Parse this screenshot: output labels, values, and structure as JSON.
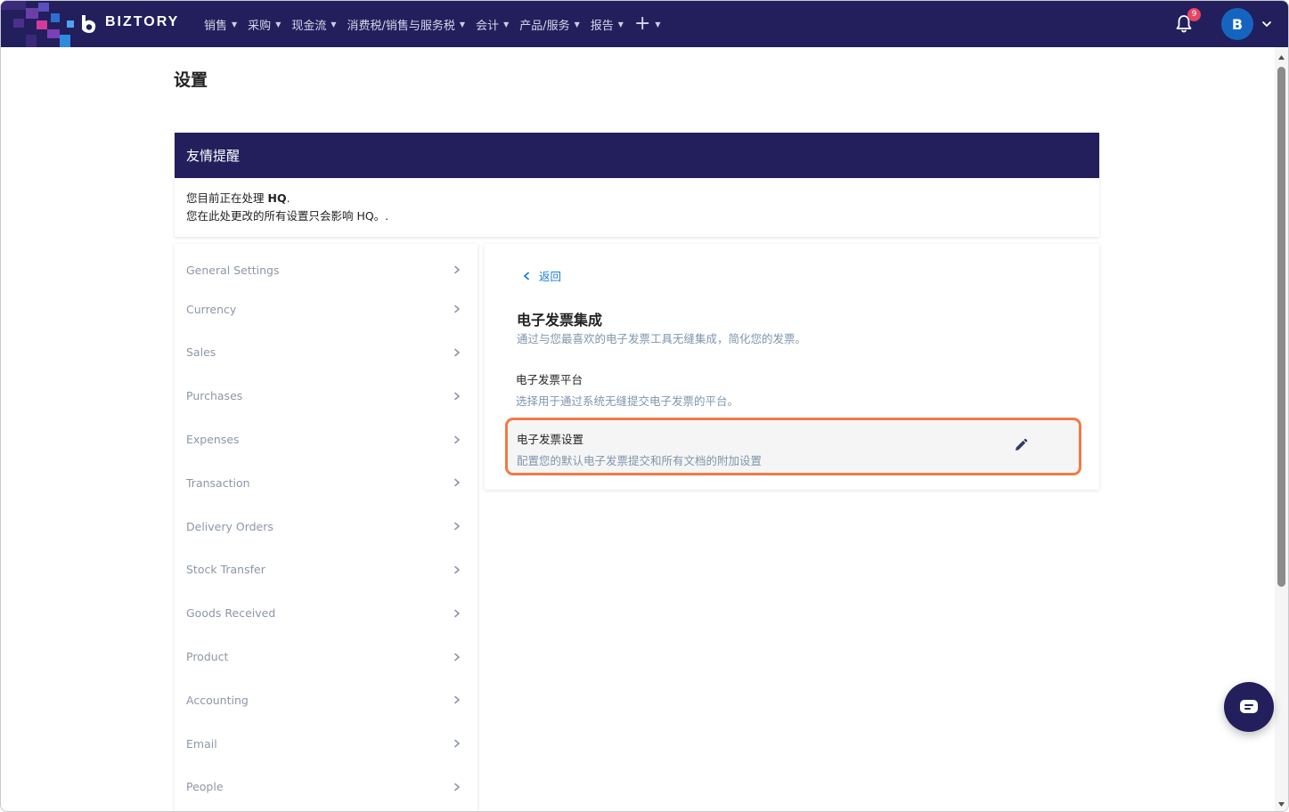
{
  "brand": {
    "name": "BIZTORY"
  },
  "nav": {
    "items": [
      {
        "label": "销售",
        "has_caret": true
      },
      {
        "label": "采购",
        "has_caret": true
      },
      {
        "label": "现金流",
        "has_caret": true
      },
      {
        "label": "消费税/销售与服务税",
        "has_caret": true
      },
      {
        "label": "会计",
        "has_caret": true
      },
      {
        "label": "产品/服务",
        "has_caret": true
      },
      {
        "label": "报告",
        "has_caret": true
      }
    ],
    "plus_label": "+",
    "notification_count": "9",
    "avatar_initial": "B"
  },
  "page": {
    "title": "设置"
  },
  "notice": {
    "heading": "友情提醒",
    "line1_prefix": "您目前正在处理 ",
    "line1_entity": "HQ",
    "line1_suffix": ".",
    "line2": "您在此处更改的所有设置只会影响 HQ。."
  },
  "sidebar": {
    "items": [
      {
        "label": "General Settings"
      },
      {
        "label": "Currency"
      },
      {
        "label": "Sales"
      },
      {
        "label": "Purchases"
      },
      {
        "label": "Expenses"
      },
      {
        "label": "Transaction"
      },
      {
        "label": "Delivery Orders"
      },
      {
        "label": "Stock Transfer"
      },
      {
        "label": "Goods Received"
      },
      {
        "label": "Product"
      },
      {
        "label": "Accounting"
      },
      {
        "label": "Email"
      },
      {
        "label": "People"
      }
    ]
  },
  "main": {
    "back_label": "返回",
    "section_title": "电子发票集成",
    "section_desc": "通过与您最喜欢的电子发票工具无缝集成，简化您的发票。",
    "platform": {
      "title": "电子发票平台",
      "desc": "选择用于通过系统无缝提交电子发票的平台。"
    },
    "settings": {
      "title": "电子发票设置",
      "desc": "配置您的默认电子发票提交和所有文档的附加设置"
    }
  },
  "colors": {
    "nav_bg": "#221f5c",
    "link": "#1a7fd6",
    "highlight_border": "#f07b45",
    "badge": "#e64563",
    "avatar": "#1565c0"
  },
  "icons": {
    "bell": "bell-icon",
    "chevron_right": "chevron-right-icon",
    "chevron_left": "chevron-left-icon",
    "edit": "pencil-icon",
    "chat": "chat-icon"
  }
}
